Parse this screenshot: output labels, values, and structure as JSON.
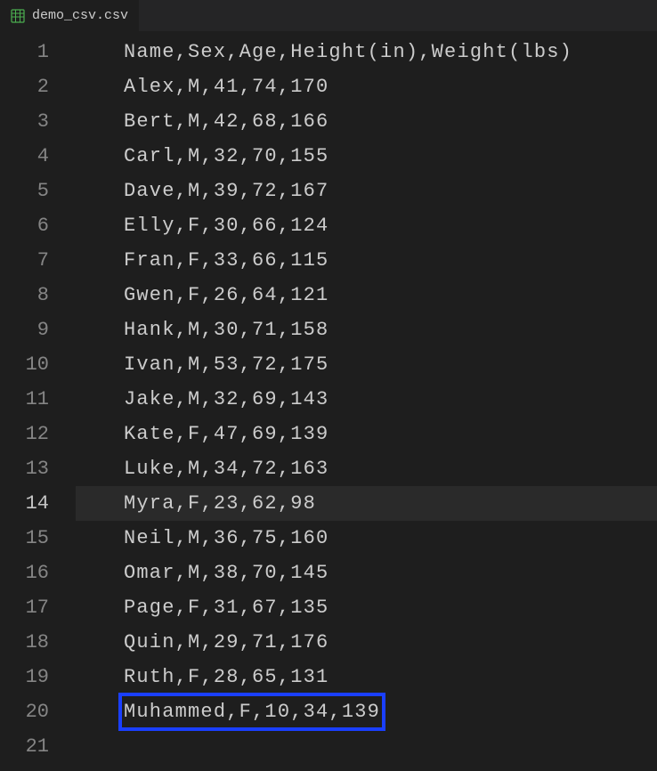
{
  "tab": {
    "filename": "demo_csv.csv"
  },
  "editor": {
    "activeLine": 14,
    "highlightedLine": 20,
    "lines": [
      {
        "number": 1,
        "content": "Name,Sex,Age,Height(in),Weight(lbs)"
      },
      {
        "number": 2,
        "content": "Alex,M,41,74,170"
      },
      {
        "number": 3,
        "content": "Bert,M,42,68,166"
      },
      {
        "number": 4,
        "content": "Carl,M,32,70,155"
      },
      {
        "number": 5,
        "content": "Dave,M,39,72,167"
      },
      {
        "number": 6,
        "content": "Elly,F,30,66,124"
      },
      {
        "number": 7,
        "content": "Fran,F,33,66,115"
      },
      {
        "number": 8,
        "content": "Gwen,F,26,64,121"
      },
      {
        "number": 9,
        "content": "Hank,M,30,71,158"
      },
      {
        "number": 10,
        "content": "Ivan,M,53,72,175"
      },
      {
        "number": 11,
        "content": "Jake,M,32,69,143"
      },
      {
        "number": 12,
        "content": "Kate,F,47,69,139"
      },
      {
        "number": 13,
        "content": "Luke,M,34,72,163"
      },
      {
        "number": 14,
        "content": "Myra,F,23,62,98"
      },
      {
        "number": 15,
        "content": "Neil,M,36,75,160"
      },
      {
        "number": 16,
        "content": "Omar,M,38,70,145"
      },
      {
        "number": 17,
        "content": "Page,F,31,67,135"
      },
      {
        "number": 18,
        "content": "Quin,M,29,71,176"
      },
      {
        "number": 19,
        "content": "Ruth,F,28,65,131"
      },
      {
        "number": 20,
        "content": "Muhammed,F,10,34,139"
      },
      {
        "number": 21,
        "content": ""
      }
    ]
  }
}
